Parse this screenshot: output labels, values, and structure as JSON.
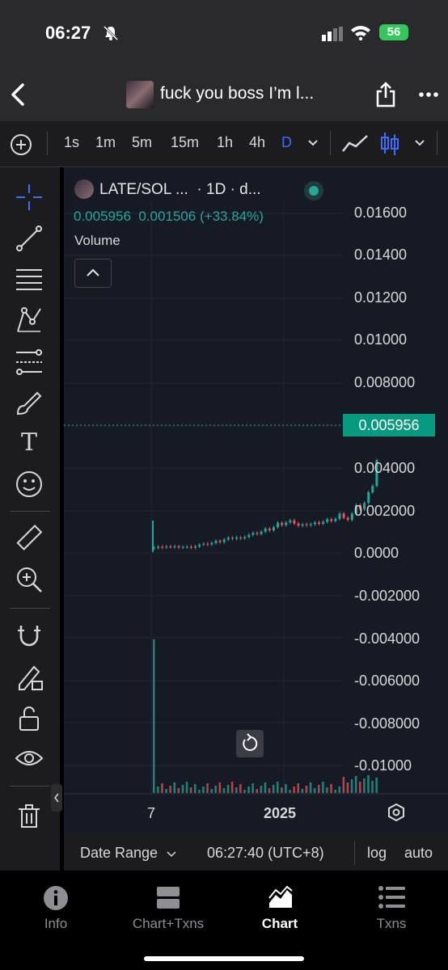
{
  "status": {
    "time": "06:27",
    "battery": "56"
  },
  "header": {
    "title": "fuck you boss I’m l..."
  },
  "toolbar": {
    "timeframes": [
      "1s",
      "1m",
      "5m",
      "15m",
      "1h",
      "4h",
      "D"
    ],
    "active_timeframe": "D"
  },
  "chart": {
    "pair": "LATE/SOL ...",
    "interval": "· 1D · d...",
    "ohlc": "0.005956  0.001506 (+33.84%)",
    "volume_label": "Volume",
    "current_price": "0.005956",
    "y_labels": [
      "0.01600",
      "0.01400",
      "0.01200",
      "0.01000",
      "0.008000",
      "0.004000",
      "0.002000",
      "0.0000",
      "-0.002000",
      "-0.004000",
      "-0.006000",
      "-0.008000",
      "-0.01000"
    ],
    "x_labels": [
      "7",
      "2025"
    ]
  },
  "bottom_bar": {
    "date_range": "Date Range",
    "clock": "06:27:40 (UTC+8)",
    "log": "log",
    "auto": "auto"
  },
  "tabs": [
    {
      "label": "Info",
      "icon": "info-icon"
    },
    {
      "label": "Chart+Txns",
      "icon": "split-icon"
    },
    {
      "label": "Chart",
      "icon": "chart-icon"
    },
    {
      "label": "Txns",
      "icon": "list-icon"
    }
  ],
  "active_tab": "Chart",
  "colors": {
    "up": "#26a69a",
    "down": "#ef5350",
    "accent": "#3d6dff",
    "price_tag": "#089981"
  }
}
